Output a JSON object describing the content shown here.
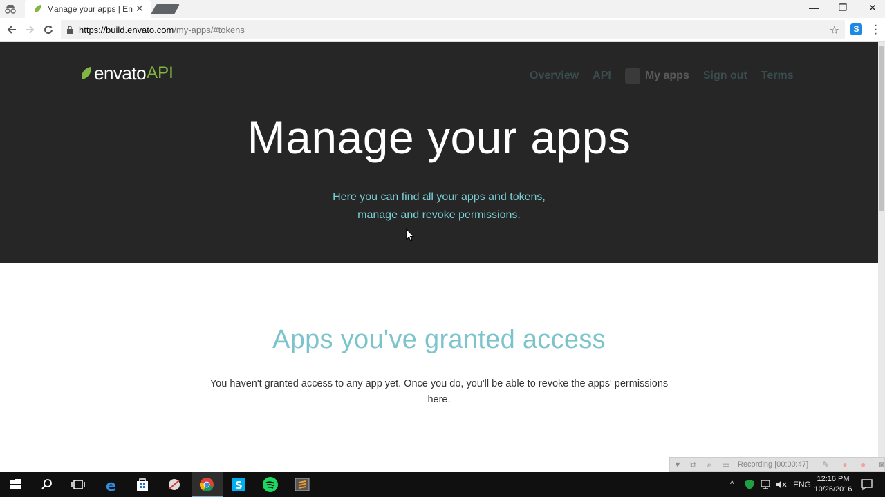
{
  "browser": {
    "tab_title": "Manage your apps | Enva",
    "tab_close": "✕",
    "url_domain": "https://build.envato.com",
    "url_path": "/my-apps/#tokens",
    "window_minimize": "—",
    "window_restore": "❐",
    "window_close": "✕",
    "extension_label": "S"
  },
  "site": {
    "logo_text": "envato",
    "logo_api": "API",
    "nav": {
      "overview": "Overview",
      "api": "API",
      "my_apps": "My apps",
      "sign_out": "Sign out",
      "terms": "Terms"
    }
  },
  "hero": {
    "title": "Manage your apps",
    "subtitle_line1": "Here you can find all your apps and tokens,",
    "subtitle_line2": "manage and revoke permissions."
  },
  "granted": {
    "title": "Apps you've granted access",
    "body": "You haven't granted access to any app yet. Once you do, you'll be able to revoke the apps' permissions here."
  },
  "recorder": {
    "status": "Recording [00:00:47]"
  },
  "taskbar": {
    "language": "ENG",
    "time": "12:16 PM",
    "date": "10/26/2016"
  },
  "colors": {
    "hero_bg": "#262626",
    "accent_teal": "#7ad0d7",
    "envato_green": "#82b541"
  }
}
